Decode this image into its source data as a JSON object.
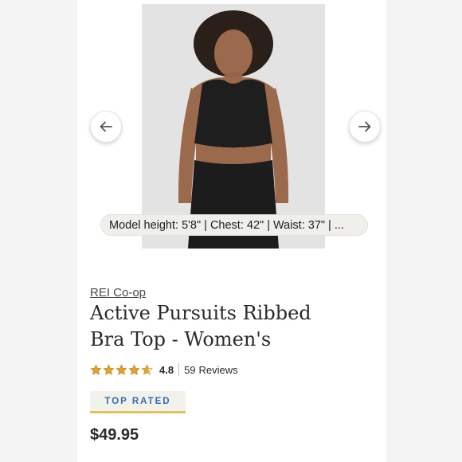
{
  "product": {
    "model_caption": "Model height: 5'8\" | Chest: 42\" | Waist: 37\" | ...",
    "brand": "REI Co-op",
    "title_line1": "Active Pursuits Ribbed",
    "title_line2": "Bra Top - Women's",
    "rating": {
      "value": "4.8",
      "stars_out_of_5": 4.8,
      "count": "59",
      "reviews_label": "Reviews"
    },
    "badge": "TOP RATED",
    "price": "$49.95"
  },
  "icons": {
    "prev": "arrow-left-icon",
    "next": "arrow-right-icon",
    "star": "star-icon"
  },
  "colors": {
    "star": "#e2a32b",
    "badge_text": "#2f6fb0",
    "badge_underline": "#e2c45a"
  }
}
